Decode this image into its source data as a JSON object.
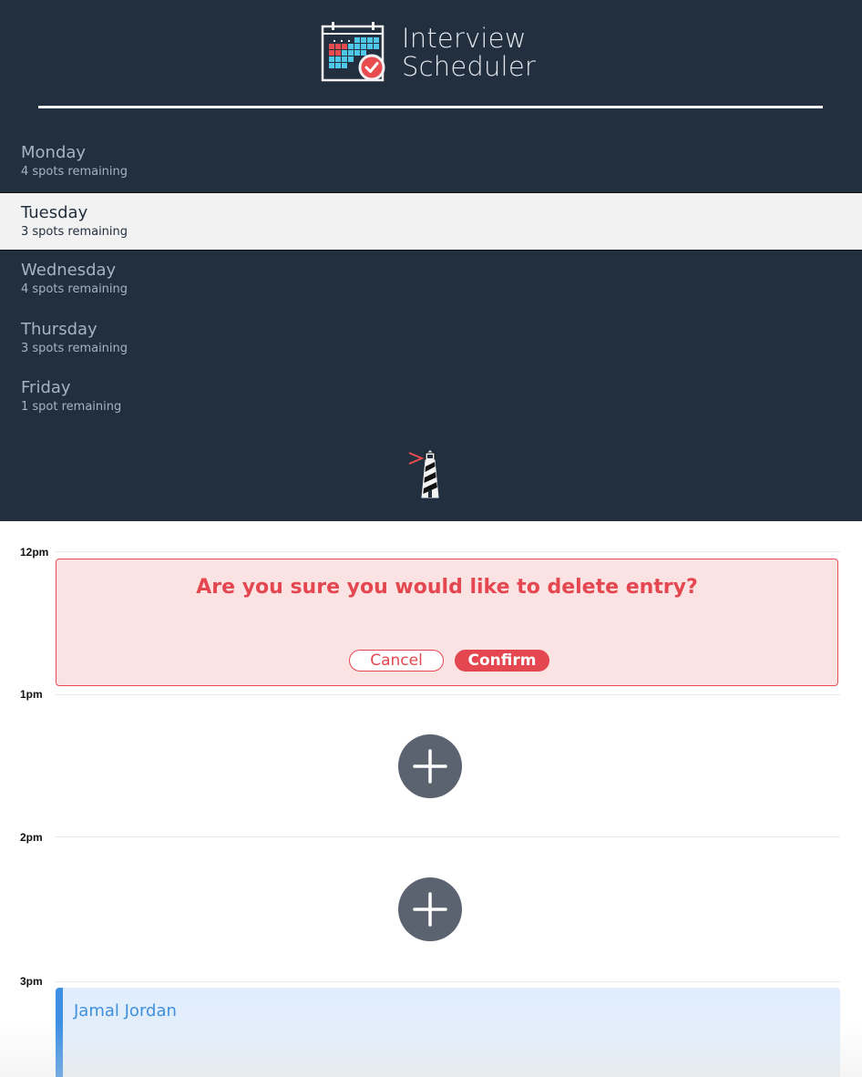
{
  "app": {
    "title_line1": "Interview",
    "title_line2": "Scheduler"
  },
  "days": [
    {
      "name": "Monday",
      "spots": "4 spots remaining",
      "selected": false
    },
    {
      "name": "Tuesday",
      "spots": "3 spots remaining",
      "selected": true
    },
    {
      "name": "Wednesday",
      "spots": "4 spots remaining",
      "selected": false
    },
    {
      "name": "Thursday",
      "spots": "3 spots remaining",
      "selected": false
    },
    {
      "name": "Friday",
      "spots": "1 spot remaining",
      "selected": false
    }
  ],
  "schedule": {
    "hours": [
      "12pm",
      "1pm",
      "2pm",
      "3pm"
    ],
    "confirm": {
      "message": "Are you sure you would like to delete entry?",
      "cancel_label": "Cancel",
      "confirm_label": "Confirm"
    },
    "appointment": {
      "student": "Jamal Jordan"
    }
  },
  "icons": {
    "logo": "calendar-check-icon",
    "brand": "lighthouse-icon",
    "add": "plus-icon"
  },
  "colors": {
    "sidebar_bg": "#222f3e",
    "danger": "#e4474f",
    "danger_bg": "#fbe3e4",
    "add_button": "#5b6370",
    "appointment_accent": "#3d8fe3",
    "appointment_bg": "#e0edfc"
  }
}
